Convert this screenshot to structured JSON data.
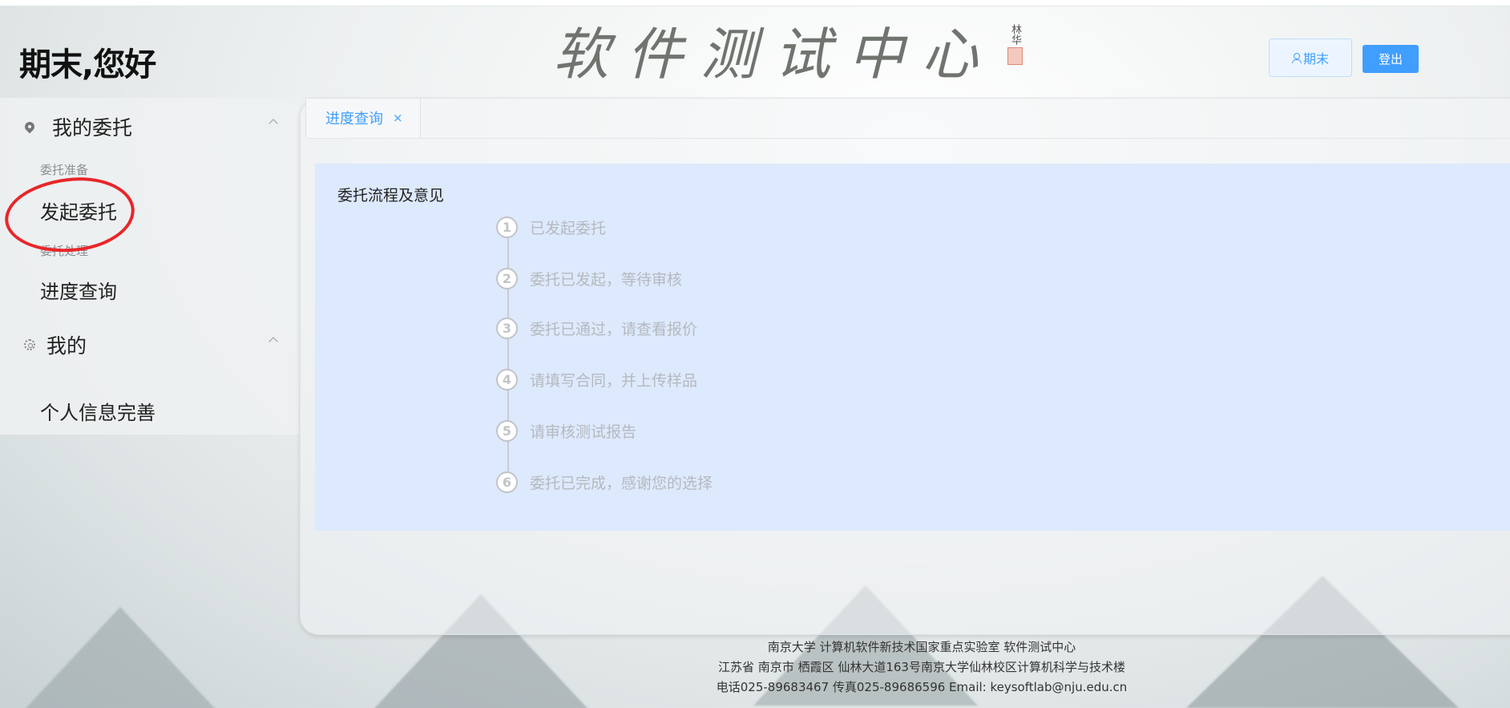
{
  "header": {
    "greeting": "期末,您好",
    "logo_text": "软件测试中心",
    "logo_signature": "林华",
    "user_button_label": "期末",
    "logout_label": "登出"
  },
  "sidebar": {
    "menus": [
      {
        "title": "我的委托",
        "icon": "location-pin-icon",
        "groups": [
          {
            "label": "委托准备",
            "items": [
              "发起委托"
            ]
          },
          {
            "label": "委托处理",
            "items": [
              "进度查询"
            ]
          }
        ]
      },
      {
        "title": "我的",
        "icon": "gear-icon",
        "items": [
          "个人信息完善"
        ]
      }
    ]
  },
  "tabs": [
    {
      "label": "进度查询",
      "close": "×"
    }
  ],
  "process": {
    "title": "委托流程及意见",
    "steps": [
      {
        "num": "1",
        "text": "已发起委托"
      },
      {
        "num": "2",
        "text": "委托已发起，等待审核"
      },
      {
        "num": "3",
        "text": "委托已通过，请查看报价"
      },
      {
        "num": "4",
        "text": "请填写合同，并上传样品"
      },
      {
        "num": "5",
        "text": "请审核测试报告"
      },
      {
        "num": "6",
        "text": "委托已完成，感谢您的选择"
      }
    ]
  },
  "footer": {
    "line1": "南京大学 计算机软件新技术国家重点实验室 软件测试中心",
    "line2": "江苏省 南京市 栖霞区 仙林大道163号南京大学仙林校区计算机科学与技术楼",
    "line3": "电话025-89683467 传真025-89686596 Email: keysoftlab@nju.edu.cn"
  },
  "colors": {
    "accent": "#409eff",
    "annotation": "#e8262a",
    "card_background": "#dde9fc"
  }
}
